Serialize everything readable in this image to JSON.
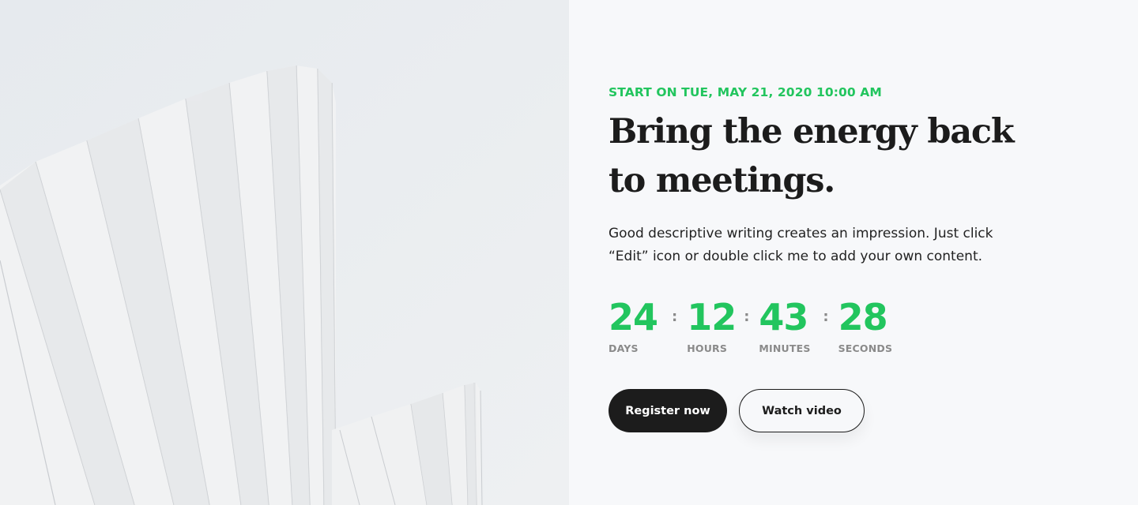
{
  "event": {
    "start_label": "START ON TUE, MAY 21, 2020 10:00 AM"
  },
  "hero": {
    "headline": "Bring the energy back to meetings.",
    "description": "Good descriptive writing creates an impression. Just click “Edit” icon or double click me to add your own content."
  },
  "countdown": {
    "separator": ":",
    "days": {
      "value": "24",
      "label": "DAYS"
    },
    "hours": {
      "value": "12",
      "label": "HOURS"
    },
    "minutes": {
      "value": "43",
      "label": "MINUTES"
    },
    "seconds": {
      "value": "28",
      "label": "SECONDS"
    }
  },
  "actions": {
    "register_label": "Register now",
    "watch_label": "Watch video"
  },
  "colors": {
    "accent": "#22c55e",
    "dark": "#1c1c1c",
    "muted": "#8a8a8a",
    "background": "#f7f8fa"
  }
}
